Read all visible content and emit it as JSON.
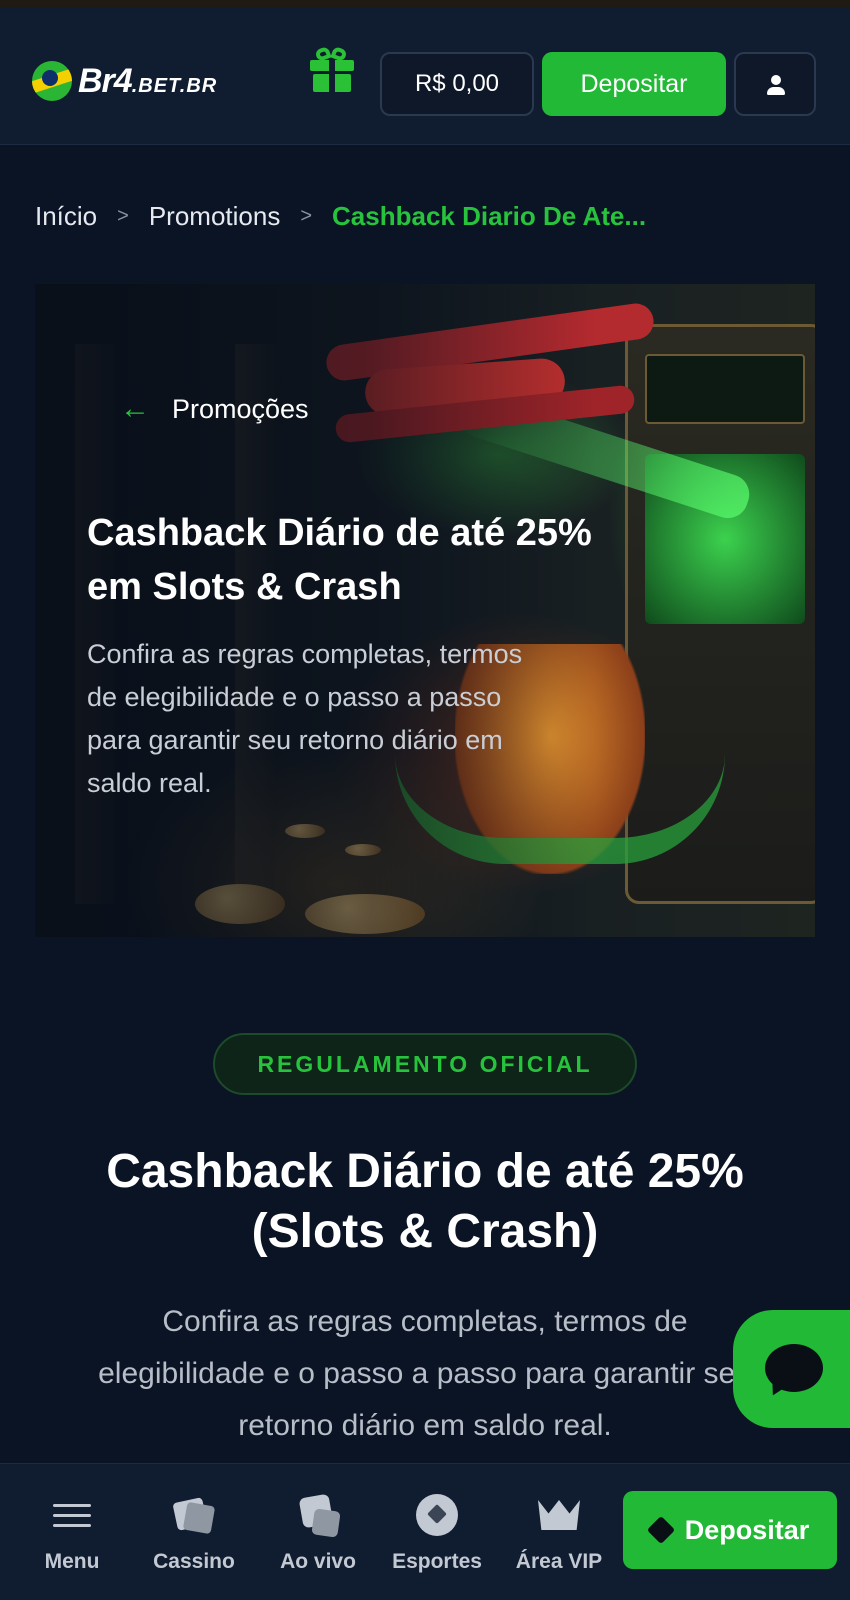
{
  "header": {
    "logo_text": "Br4",
    "logo_suffix": ".BET.BR",
    "balance": "R$ 0,00",
    "deposit_label": "Depositar"
  },
  "breadcrumb": {
    "items": [
      "Início",
      "Promotions"
    ],
    "separator": ">",
    "current": "Cashback Diario De Ate..."
  },
  "hero": {
    "back_label": "Promoções",
    "title": "Cashback Diário de até 25% em Slots & Crash",
    "description": "Confira as regras completas, termos de elegibilidade e o passo a passo para garantir seu retorno diário em saldo real."
  },
  "regulation": {
    "badge": "REGULAMENTO OFICIAL",
    "title": "Cashback Diário de até 25% (Slots & Crash)",
    "description": "Confira as regras completas, termos de elegibilidade e o passo a passo para garantir seu retorno diário em saldo real."
  },
  "bottom_nav": {
    "items": [
      {
        "label": "Menu",
        "icon": "menu-icon"
      },
      {
        "label": "Cassino",
        "icon": "cards-icon"
      },
      {
        "label": "Ao vivo",
        "icon": "dice-icon"
      },
      {
        "label": "Esportes",
        "icon": "soccer-ball-icon"
      },
      {
        "label": "Área VIP",
        "icon": "crown-icon"
      }
    ],
    "deposit_label": "Depositar"
  },
  "colors": {
    "accent": "#22b936",
    "background": "#0b1424",
    "header": "#101c30"
  }
}
